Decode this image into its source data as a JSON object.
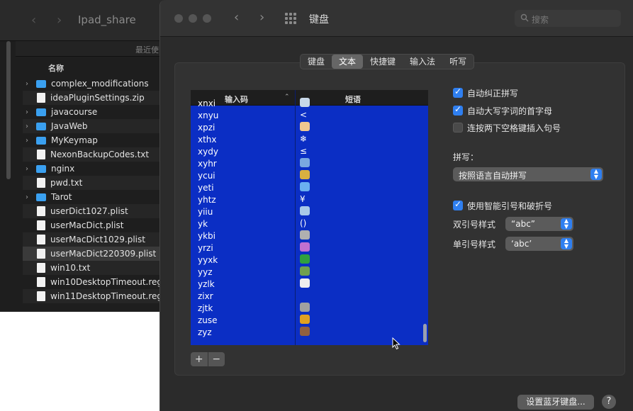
{
  "finder": {
    "title": "Ipad_share",
    "recent_label": "最近使",
    "name_header": "名称",
    "files": [
      {
        "name": "complex_modifications",
        "type": "folder"
      },
      {
        "name": "ideaPluginSettings.zip",
        "type": "file"
      },
      {
        "name": "javacourse",
        "type": "folder"
      },
      {
        "name": "JavaWeb",
        "type": "folder"
      },
      {
        "name": "MyKeymap",
        "type": "folder"
      },
      {
        "name": "NexonBackupCodes.txt",
        "type": "file"
      },
      {
        "name": "nginx",
        "type": "folder"
      },
      {
        "name": "pwd.txt",
        "type": "file"
      },
      {
        "name": "Tarot",
        "type": "folder"
      },
      {
        "name": "userDict1027.plist",
        "type": "file"
      },
      {
        "name": "userMacDict.plist",
        "type": "file"
      },
      {
        "name": "userMacDict1029.plist",
        "type": "file"
      },
      {
        "name": "userMacDict220309.plist",
        "type": "file"
      },
      {
        "name": "win10.txt",
        "type": "file"
      },
      {
        "name": "win10DesktopTimeout.reg",
        "type": "file"
      },
      {
        "name": "win11DesktopTimeout.reg",
        "type": "file"
      }
    ]
  },
  "window": {
    "title": "键盘",
    "search_placeholder": "搜索"
  },
  "tabs": [
    {
      "label": "键盘"
    },
    {
      "label": "文本",
      "active": true
    },
    {
      "label": "快捷键"
    },
    {
      "label": "输入法"
    },
    {
      "label": "听写"
    }
  ],
  "table": {
    "col_code": "输入码",
    "col_phrase": "短语",
    "rows": [
      {
        "code": "xnxi",
        "phrase": "",
        "icon": "globe-emoji"
      },
      {
        "code": "xnyu",
        "phrase": "<"
      },
      {
        "code": "xpzi",
        "phrase": "",
        "icon": "writing-hand-emoji"
      },
      {
        "code": "xthx",
        "phrase": "❄"
      },
      {
        "code": "xydy",
        "phrase": "≤"
      },
      {
        "code": "xyhr",
        "phrase": "",
        "icon": "cycle-emoji"
      },
      {
        "code": "ycui",
        "phrase": "",
        "icon": "key-emoji"
      },
      {
        "code": "yeti",
        "phrase": "",
        "icon": "droplet-emoji"
      },
      {
        "code": "yhtz",
        "phrase": "¥"
      },
      {
        "code": "yiiu",
        "phrase": "",
        "icon": "wave-emoji"
      },
      {
        "code": "yk",
        "phrase": "()"
      },
      {
        "code": "ykbi",
        "phrase": "",
        "icon": "moon-emoji"
      },
      {
        "code": "yrzi",
        "phrase": "",
        "icon": "atom-emoji"
      },
      {
        "code": "yyxk",
        "phrase": "",
        "icon": "earth-emoji"
      },
      {
        "code": "yyz",
        "phrase": "",
        "icon": "branch-emoji"
      },
      {
        "code": "yzlk",
        "phrase": "",
        "icon": "ghost-emoji"
      },
      {
        "code": "zixr",
        "phrase": ""
      },
      {
        "code": "zjtk",
        "phrase": "",
        "icon": "pause-emoji"
      },
      {
        "code": "zuse",
        "phrase": "",
        "icon": "barrier-emoji"
      },
      {
        "code": "zyz",
        "phrase": "",
        "icon": "boot-emoji"
      }
    ],
    "add_label": "+",
    "remove_label": "−"
  },
  "options": {
    "autocorrect": {
      "label": "自动纠正拼写",
      "checked": true
    },
    "autocap": {
      "label": "自动大写字词的首字母",
      "checked": true
    },
    "double_space": {
      "label": "连按两下空格键插入句号",
      "checked": false
    },
    "spelling_label": "拼写：",
    "spelling_value": "按照语言自动拼写",
    "smart_quotes": {
      "label": "使用智能引号和破折号",
      "checked": true
    },
    "double_quote_label": "双引号样式",
    "double_quote_value": "“abc”",
    "single_quote_label": "单引号样式",
    "single_quote_value": "‘abc’"
  },
  "footer": {
    "bluetooth_button": "设置蓝牙键盘...",
    "help": "?"
  },
  "colors": {
    "accent": "#2f7ff0",
    "table_bg": "#0b2ec4"
  }
}
